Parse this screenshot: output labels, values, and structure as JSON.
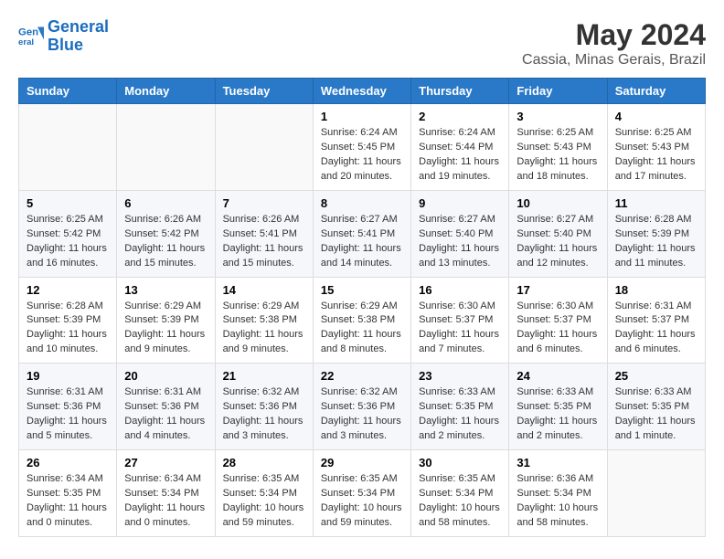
{
  "logo": {
    "line1": "General",
    "line2": "Blue"
  },
  "title": "May 2024",
  "location": "Cassia, Minas Gerais, Brazil",
  "weekdays": [
    "Sunday",
    "Monday",
    "Tuesday",
    "Wednesday",
    "Thursday",
    "Friday",
    "Saturday"
  ],
  "weeks": [
    [
      {
        "day": "",
        "info": ""
      },
      {
        "day": "",
        "info": ""
      },
      {
        "day": "",
        "info": ""
      },
      {
        "day": "1",
        "info": "Sunrise: 6:24 AM\nSunset: 5:45 PM\nDaylight: 11 hours\nand 20 minutes."
      },
      {
        "day": "2",
        "info": "Sunrise: 6:24 AM\nSunset: 5:44 PM\nDaylight: 11 hours\nand 19 minutes."
      },
      {
        "day": "3",
        "info": "Sunrise: 6:25 AM\nSunset: 5:43 PM\nDaylight: 11 hours\nand 18 minutes."
      },
      {
        "day": "4",
        "info": "Sunrise: 6:25 AM\nSunset: 5:43 PM\nDaylight: 11 hours\nand 17 minutes."
      }
    ],
    [
      {
        "day": "5",
        "info": "Sunrise: 6:25 AM\nSunset: 5:42 PM\nDaylight: 11 hours\nand 16 minutes."
      },
      {
        "day": "6",
        "info": "Sunrise: 6:26 AM\nSunset: 5:42 PM\nDaylight: 11 hours\nand 15 minutes."
      },
      {
        "day": "7",
        "info": "Sunrise: 6:26 AM\nSunset: 5:41 PM\nDaylight: 11 hours\nand 15 minutes."
      },
      {
        "day": "8",
        "info": "Sunrise: 6:27 AM\nSunset: 5:41 PM\nDaylight: 11 hours\nand 14 minutes."
      },
      {
        "day": "9",
        "info": "Sunrise: 6:27 AM\nSunset: 5:40 PM\nDaylight: 11 hours\nand 13 minutes."
      },
      {
        "day": "10",
        "info": "Sunrise: 6:27 AM\nSunset: 5:40 PM\nDaylight: 11 hours\nand 12 minutes."
      },
      {
        "day": "11",
        "info": "Sunrise: 6:28 AM\nSunset: 5:39 PM\nDaylight: 11 hours\nand 11 minutes."
      }
    ],
    [
      {
        "day": "12",
        "info": "Sunrise: 6:28 AM\nSunset: 5:39 PM\nDaylight: 11 hours\nand 10 minutes."
      },
      {
        "day": "13",
        "info": "Sunrise: 6:29 AM\nSunset: 5:39 PM\nDaylight: 11 hours\nand 9 minutes."
      },
      {
        "day": "14",
        "info": "Sunrise: 6:29 AM\nSunset: 5:38 PM\nDaylight: 11 hours\nand 9 minutes."
      },
      {
        "day": "15",
        "info": "Sunrise: 6:29 AM\nSunset: 5:38 PM\nDaylight: 11 hours\nand 8 minutes."
      },
      {
        "day": "16",
        "info": "Sunrise: 6:30 AM\nSunset: 5:37 PM\nDaylight: 11 hours\nand 7 minutes."
      },
      {
        "day": "17",
        "info": "Sunrise: 6:30 AM\nSunset: 5:37 PM\nDaylight: 11 hours\nand 6 minutes."
      },
      {
        "day": "18",
        "info": "Sunrise: 6:31 AM\nSunset: 5:37 PM\nDaylight: 11 hours\nand 6 minutes."
      }
    ],
    [
      {
        "day": "19",
        "info": "Sunrise: 6:31 AM\nSunset: 5:36 PM\nDaylight: 11 hours\nand 5 minutes."
      },
      {
        "day": "20",
        "info": "Sunrise: 6:31 AM\nSunset: 5:36 PM\nDaylight: 11 hours\nand 4 minutes."
      },
      {
        "day": "21",
        "info": "Sunrise: 6:32 AM\nSunset: 5:36 PM\nDaylight: 11 hours\nand 3 minutes."
      },
      {
        "day": "22",
        "info": "Sunrise: 6:32 AM\nSunset: 5:36 PM\nDaylight: 11 hours\nand 3 minutes."
      },
      {
        "day": "23",
        "info": "Sunrise: 6:33 AM\nSunset: 5:35 PM\nDaylight: 11 hours\nand 2 minutes."
      },
      {
        "day": "24",
        "info": "Sunrise: 6:33 AM\nSunset: 5:35 PM\nDaylight: 11 hours\nand 2 minutes."
      },
      {
        "day": "25",
        "info": "Sunrise: 6:33 AM\nSunset: 5:35 PM\nDaylight: 11 hours\nand 1 minute."
      }
    ],
    [
      {
        "day": "26",
        "info": "Sunrise: 6:34 AM\nSunset: 5:35 PM\nDaylight: 11 hours\nand 0 minutes."
      },
      {
        "day": "27",
        "info": "Sunrise: 6:34 AM\nSunset: 5:34 PM\nDaylight: 11 hours\nand 0 minutes."
      },
      {
        "day": "28",
        "info": "Sunrise: 6:35 AM\nSunset: 5:34 PM\nDaylight: 10 hours\nand 59 minutes."
      },
      {
        "day": "29",
        "info": "Sunrise: 6:35 AM\nSunset: 5:34 PM\nDaylight: 10 hours\nand 59 minutes."
      },
      {
        "day": "30",
        "info": "Sunrise: 6:35 AM\nSunset: 5:34 PM\nDaylight: 10 hours\nand 58 minutes."
      },
      {
        "day": "31",
        "info": "Sunrise: 6:36 AM\nSunset: 5:34 PM\nDaylight: 10 hours\nand 58 minutes."
      },
      {
        "day": "",
        "info": ""
      }
    ]
  ]
}
